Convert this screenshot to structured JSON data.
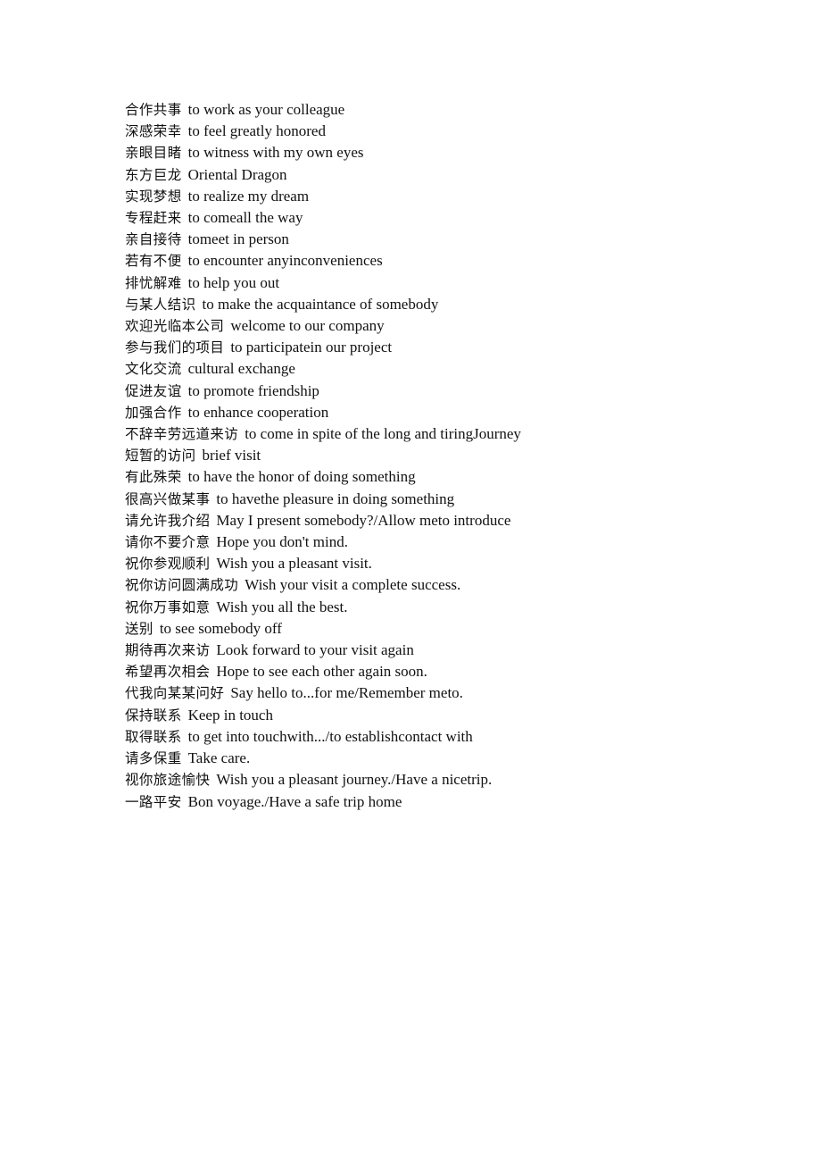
{
  "document": {
    "page_background": "#ffffff",
    "text_color": "#111111",
    "title": "合作共事 to work as your colleague",
    "entries": [
      {
        "zh": "合作共事",
        "en": "to work as your colleague"
      },
      {
        "zh": "深感荣幸",
        "en": "to feel greatly honored"
      },
      {
        "zh": "亲眼目睹",
        "en": "to witness with my own eyes"
      },
      {
        "zh": "东方巨龙",
        "en": "Oriental Dragon"
      },
      {
        "zh": "实现梦想",
        "en": "to realize my dream"
      },
      {
        "zh": "专程赶来",
        "en": "to comeall the way"
      },
      {
        "zh": "亲自接待",
        "en": "tomeet in person"
      },
      {
        "zh": "若有不便",
        "en": "to encounter anyinconveniences"
      },
      {
        "zh": "排忧解难",
        "en": "to help you out"
      },
      {
        "zh": "与某人结识",
        "en": "to make the acquaintance of somebody"
      },
      {
        "zh": "欢迎光临本公司",
        "en": "welcome to our company"
      },
      {
        "zh": "参与我们的项目",
        "en": "to participatein our project"
      },
      {
        "zh": "文化交流",
        "en": "cultural exchange"
      },
      {
        "zh": "促进友谊",
        "en": "to promote friendship"
      },
      {
        "zh": "加强合作",
        "en": "to enhance cooperation"
      },
      {
        "zh": "不辞辛劳远道来访",
        "en": "to come in spite of the long and tiringJourney"
      },
      {
        "zh": "短暂的访问",
        "en": "brief visit"
      },
      {
        "zh": "有此殊荣",
        "en": "to have the honor of doing something"
      },
      {
        "zh": "很高兴做某事",
        "en": "to havethe pleasure in doing something"
      },
      {
        "zh": "请允许我介绍",
        "en": "May I present somebody?/Allow meto introduce"
      },
      {
        "zh": "请你不要介意",
        "en": "Hope you don't mind."
      },
      {
        "zh": "祝你参观顺利",
        "en": "Wish you a pleasant visit."
      },
      {
        "zh": "祝你访问圆满成功",
        "en": "Wish your visit a complete success."
      },
      {
        "zh": "祝你万事如意",
        "en": "Wish you all the best."
      },
      {
        "zh": "送别",
        "en": "to see somebody off"
      },
      {
        "zh": "期待再次来访",
        "en": "Look forward to your visit again"
      },
      {
        "zh": "希望再次相会",
        "en": "Hope to see each other again soon."
      },
      {
        "zh": "代我向某某问好",
        "en": "Say hello to...for me/Remember meto."
      },
      {
        "zh": "保持联系",
        "en": "Keep in touch"
      },
      {
        "zh": "取得联系",
        "en": "to get into touchwith.../to establishcontact with"
      },
      {
        "zh": "请多保重",
        "en": "Take care."
      },
      {
        "zh": "视你旅途愉快",
        "en": "Wish you a pleasant journey./Have a nicetrip."
      },
      {
        "zh": "一路平安",
        "en": "Bon voyage./Have a safe trip home"
      }
    ]
  }
}
